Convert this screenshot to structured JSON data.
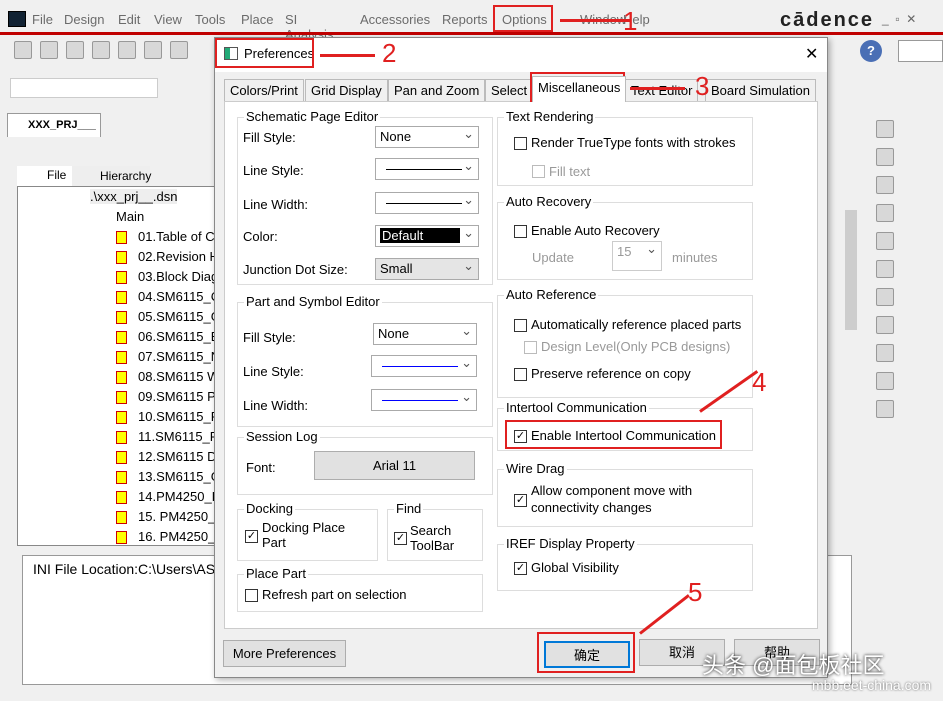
{
  "menu": [
    "File",
    "Design",
    "Edit",
    "View",
    "Tools",
    "Place",
    "SI Analysis",
    "Accessories",
    "Reports",
    "Options",
    "Window",
    "Help"
  ],
  "brand": "cādence",
  "project_tab": "XXX_PRJ___",
  "tree": {
    "tabs": [
      "File",
      "Hierarchy"
    ],
    "root": ".\\xxx_prj__.dsn",
    "folder": "Main",
    "pages": [
      "01.Table of C",
      "02.Revision H",
      "03.Block Diag",
      "04.SM6115_C",
      "05.SM6115_G",
      "06.SM6115_E",
      "07.SM6115_N",
      "08.SM6115 W",
      "09.SM6115 P",
      "10.SM6115_P",
      "11.SM6115_P",
      "12.SM6115 D",
      "13.SM6115_G",
      "14.PM4250_H",
      "15. PM4250_E",
      "16. PM4250_"
    ]
  },
  "session_log": "INI File Location:C:\\Users\\AS",
  "dialog": {
    "title": "Preferences",
    "tabs": [
      "Colors/Print",
      "Grid Display",
      "Pan and Zoom",
      "Select",
      "Miscellaneous",
      "Text Editor",
      "Board Simulation"
    ],
    "active_tab": "Miscellaneous",
    "schematic": {
      "title": "Schematic Page Editor",
      "fill_label": "Fill Style:",
      "fill": "None",
      "line_style_label": "Line Style:",
      "line_width_label": "Line Width:",
      "color_label": "Color:",
      "color": "Default",
      "junction_label": "Junction Dot Size:",
      "junction": "Small"
    },
    "part": {
      "title": "Part and Symbol Editor",
      "fill_label": "Fill Style:",
      "fill": "None",
      "line_style_label": "Line Style:",
      "line_width_label": "Line Width:"
    },
    "session": {
      "title": "Session Log",
      "font_label": "Font:",
      "font": "Arial 11"
    },
    "docking": {
      "title": "Docking",
      "label": "Docking Place Part",
      "checked": true
    },
    "find": {
      "title": "Find",
      "label": "Search ToolBar",
      "checked": true
    },
    "place_part": {
      "title": "Place Part",
      "label": "Refresh part on selection",
      "checked": false
    },
    "text_rendering": {
      "title": "Text Rendering",
      "truetype": "Render TrueType fonts with strokes",
      "fill_text": "Fill text"
    },
    "auto_recovery": {
      "title": "Auto Recovery",
      "enable": "Enable Auto Recovery",
      "update": "Update",
      "value": "15",
      "unit": "minutes"
    },
    "auto_reference": {
      "title": "Auto Reference",
      "auto": "Automatically reference placed parts",
      "design_level": "Design Level(Only PCB designs)",
      "preserve": "Preserve reference on copy"
    },
    "intertool": {
      "title": "Intertool Communication",
      "enable": "Enable Intertool Communication",
      "checked": true
    },
    "wire_drag": {
      "title": "Wire Drag",
      "allow": "Allow component move with connectivity changes",
      "checked": true
    },
    "iref": {
      "title": "IREF Display Property",
      "global": "Global Visibility",
      "checked": true
    },
    "more": "More Preferences",
    "ok": "确定",
    "cancel": "取消",
    "help": "帮助"
  },
  "annotations": [
    "1",
    "2",
    "3",
    "4",
    "5"
  ],
  "watermark": {
    "text": "头条 @面包板社区",
    "url": "mbb.eet-china.com"
  },
  "colors": {
    "annotation": "#e02020",
    "menu_bar_line": "#c00000",
    "selection_blue": "#0078d7"
  }
}
